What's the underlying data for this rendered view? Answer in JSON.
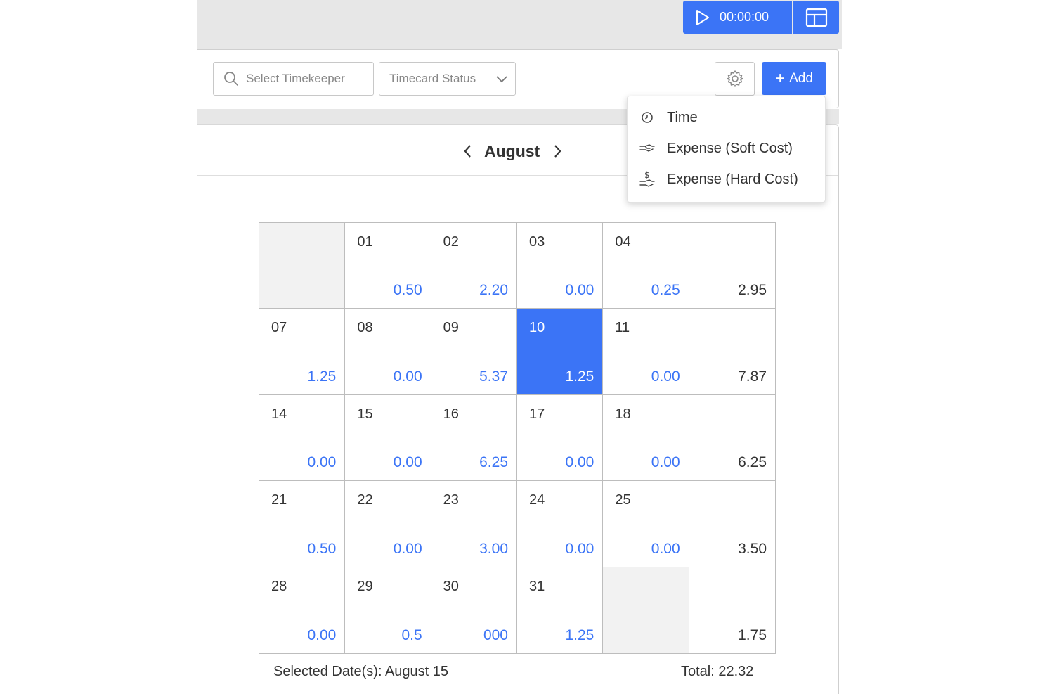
{
  "header": {
    "timer_value": "00:00:00"
  },
  "toolbar": {
    "search_placeholder": "Select Timekeeper",
    "status_placeholder": "Timecard Status",
    "add_label": "Add"
  },
  "add_menu": {
    "items": [
      {
        "label": "Time",
        "icon": "clock-icon"
      },
      {
        "label": "Expense (Soft Cost)",
        "icon": "hand-icon"
      },
      {
        "label": "Expense (Hard Cost)",
        "icon": "dollar-hand-icon"
      }
    ]
  },
  "calendar": {
    "month": "August",
    "rows": [
      [
        {
          "day": "",
          "hours": "",
          "empty": true
        },
        {
          "day": "01",
          "hours": "0.50"
        },
        {
          "day": "02",
          "hours": "2.20"
        },
        {
          "day": "03",
          "hours": "0.00"
        },
        {
          "day": "04",
          "hours": "0.25"
        },
        {
          "day": "",
          "hours": "2.95",
          "total": true
        }
      ],
      [
        {
          "day": "07",
          "hours": "1.25"
        },
        {
          "day": "08",
          "hours": "0.00"
        },
        {
          "day": "09",
          "hours": "5.37"
        },
        {
          "day": "10",
          "hours": "1.25",
          "selected": true
        },
        {
          "day": "11",
          "hours": "0.00"
        },
        {
          "day": "",
          "hours": "7.87",
          "total": true
        }
      ],
      [
        {
          "day": "14",
          "hours": "0.00"
        },
        {
          "day": "15",
          "hours": "0.00"
        },
        {
          "day": "16",
          "hours": "6.25"
        },
        {
          "day": "17",
          "hours": "0.00"
        },
        {
          "day": "18",
          "hours": "0.00"
        },
        {
          "day": "",
          "hours": "6.25",
          "total": true
        }
      ],
      [
        {
          "day": "21",
          "hours": "0.50"
        },
        {
          "day": "22",
          "hours": "0.00"
        },
        {
          "day": "23",
          "hours": "3.00"
        },
        {
          "day": "24",
          "hours": "0.00"
        },
        {
          "day": "25",
          "hours": "0.00"
        },
        {
          "day": "",
          "hours": "3.50",
          "total": true
        }
      ],
      [
        {
          "day": "28",
          "hours": "0.00"
        },
        {
          "day": "29",
          "hours": "0.5"
        },
        {
          "day": "30",
          "hours": "000"
        },
        {
          "day": "31",
          "hours": "1.25"
        },
        {
          "day": "",
          "hours": "",
          "empty": true
        },
        {
          "day": "",
          "hours": "1.75",
          "total": true
        }
      ]
    ],
    "selected_dates_text": "Selected Date(s): August 15",
    "total_text": "Total: 22.32"
  },
  "colors": {
    "accent": "#3b74f6",
    "topbar_bg": "#e7e7e7",
    "empty_cell": "#f2f2f2"
  }
}
